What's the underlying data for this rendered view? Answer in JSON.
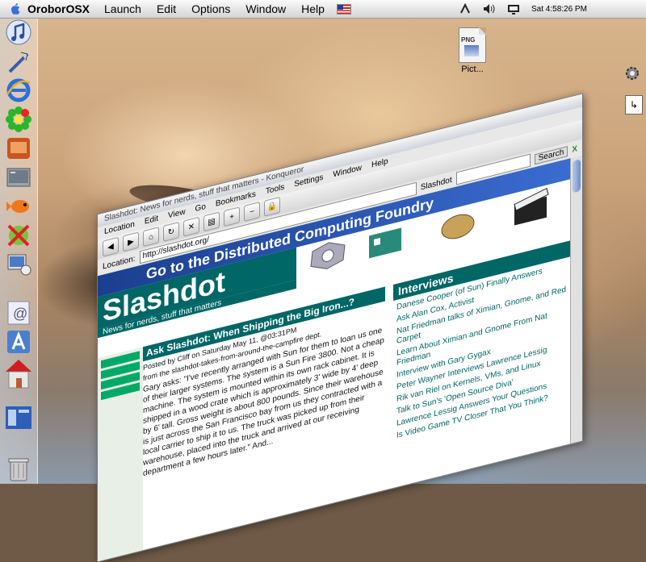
{
  "menubar": {
    "app_name": "OroborOSX",
    "items": [
      "Launch",
      "Edit",
      "Options",
      "Window",
      "Help"
    ],
    "clock": "Sat 4:58:26 PM"
  },
  "desktop": {
    "icon_type_label": "PNG",
    "icon_label": "Pict..."
  },
  "browser": {
    "title_text": "Slashdot: News for nerds, stuff that matters - Konqueror",
    "menu": [
      "Location",
      "Edit",
      "View",
      "Go",
      "Bookmarks",
      "Tools",
      "Settings",
      "Window",
      "Help"
    ],
    "location_label": "Location:",
    "url": "http://slashdot.org/",
    "search_tab": "Slashdot",
    "search_button": "Search",
    "close_label": "X",
    "banner": "Go to the Distributed Computing Foundry",
    "logo_text": "Slashdot",
    "tagline": "News for nerds, stuff that matters",
    "story": {
      "header": "Ask Slashdot: When Shipping the Big Iron...?",
      "byline": "Posted by Cliff on Saturday May 11, @03:31PM",
      "dept": "from the slashdot-takes-from-around-the-campfire dept.",
      "body": "Gary asks: \"I've recently arranged with Sun for them to loan us one of their larger systems. The system is a Sun Fire 3800. Not a cheap machine. The system is mounted within its own rack cabinet. It is shipped in a wood crate which is approximately 3' wide by 4' deep by 6' tall. Gross weight is about 800 pounds. Since their warehouse is just across the San Francisco bay from us they contracted with a local carrier to ship it to us. The truck was picked up from their warehouse, placed into the truck and arrived at our receiving department a few hours later.\" And..."
    },
    "interviews": {
      "header": "Interviews",
      "items": [
        "Danese Cooper (of Sun) Finally Answers",
        "Ask Alan Cox, Activist",
        "Nat Friedman talks of Ximian, Gnome, and Red Carpet",
        "Learn About Ximian and Gnome From Nat Friedman",
        "Interview with Gary Gygax",
        "Peter Wayner Interviews Lawrence Lessig",
        "Rik van Riel on Kernels, VMs, and Linux",
        "Talk to Sun's 'Open Source Diva'",
        "Lawrence Lessig Answers Your Questions",
        "Is Video Game TV Closer That You Think?"
      ]
    }
  }
}
